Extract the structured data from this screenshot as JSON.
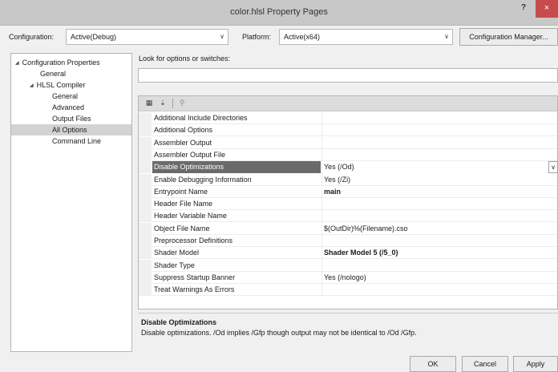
{
  "window": {
    "title": "color.hlsl Property Pages",
    "help_label": "?",
    "close_label": "×"
  },
  "config": {
    "configuration_label": "Configuration:",
    "configuration_value": "Active(Debug)",
    "platform_label": "Platform:",
    "platform_value": "Active(x64)",
    "manager_button": "Configuration Manager..."
  },
  "tree": {
    "items": [
      {
        "label": "Configuration Properties",
        "expander": "◢",
        "level": 0
      },
      {
        "label": "General",
        "level": 1
      },
      {
        "label": "HLSL Compiler",
        "expander": "◢",
        "level": 1
      },
      {
        "label": "General",
        "level": 2
      },
      {
        "label": "Advanced",
        "level": 2
      },
      {
        "label": "Output Files",
        "level": 2
      },
      {
        "label": "All Options",
        "level": 2,
        "selected": true
      },
      {
        "label": "Command Line",
        "level": 2
      }
    ]
  },
  "search": {
    "label": "Look for options or switches:",
    "value": ""
  },
  "toolbar": {
    "icons": [
      "categorized-icon",
      "alphabetical-icon",
      "property-pages-icon"
    ]
  },
  "properties": [
    {
      "name": "Additional Include Directories",
      "value": ""
    },
    {
      "name": "Additional Options",
      "value": ""
    },
    {
      "name": "Assembler Output",
      "value": ""
    },
    {
      "name": "Assembler Output File",
      "value": ""
    },
    {
      "name": "Disable Optimizations",
      "value": "Yes (/Od)",
      "selected": true
    },
    {
      "name": "Enable Debugging Information",
      "value": "Yes (/Zi)"
    },
    {
      "name": "Entrypoint Name",
      "value": "main",
      "bold": true
    },
    {
      "name": "Header File Name",
      "value": ""
    },
    {
      "name": "Header Variable Name",
      "value": ""
    },
    {
      "name": "Object File Name",
      "value": "$(OutDir)%(Filename).cso"
    },
    {
      "name": "Preprocessor Definitions",
      "value": ""
    },
    {
      "name": "Shader Model",
      "value": "Shader Model 5 (/5_0)",
      "bold": true
    },
    {
      "name": "Shader Type",
      "value": ""
    },
    {
      "name": "Suppress Startup Banner",
      "value": "Yes (/nologo)"
    },
    {
      "name": "Treat Warnings As Errors",
      "value": ""
    }
  ],
  "description": {
    "title": "Disable Optimizations",
    "text": "Disable optimizations. /Od implies /Gfp though output may not be identical to /Od /Gfp."
  },
  "buttons": {
    "ok": "OK",
    "cancel": "Cancel",
    "apply": "Apply"
  }
}
